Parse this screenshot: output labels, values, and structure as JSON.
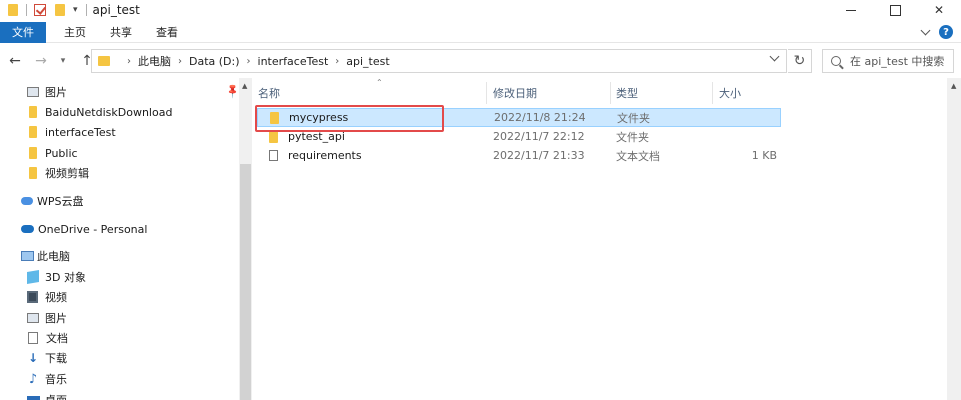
{
  "window": {
    "title": "api_test"
  },
  "ribbon": {
    "tabs": [
      "文件",
      "主页",
      "共享",
      "查看"
    ]
  },
  "address": {
    "crumbs": [
      "此电脑",
      "Data (D:)",
      "interfaceTest",
      "api_test"
    ]
  },
  "search": {
    "placeholder": "在 api_test 中搜索"
  },
  "sidebar": {
    "items": [
      {
        "label": "图片",
        "icon": "pictures-icon"
      },
      {
        "label": "BaiduNetdiskDownload",
        "icon": "folder-icon"
      },
      {
        "label": "interfaceTest",
        "icon": "folder-icon"
      },
      {
        "label": "Public",
        "icon": "folder-icon"
      },
      {
        "label": "视频剪辑",
        "icon": "folder-icon"
      },
      {
        "label": "WPS云盘",
        "icon": "cloud-icon"
      },
      {
        "label": "OneDrive - Personal",
        "icon": "onedrive-icon"
      },
      {
        "label": "此电脑",
        "icon": "this-pc-icon"
      },
      {
        "label": "3D 对象",
        "icon": "3d-objects-icon"
      },
      {
        "label": "视频",
        "icon": "videos-icon"
      },
      {
        "label": "图片",
        "icon": "pictures-icon"
      },
      {
        "label": "文档",
        "icon": "documents-icon"
      },
      {
        "label": "下载",
        "icon": "downloads-icon"
      },
      {
        "label": "音乐",
        "icon": "music-icon"
      },
      {
        "label": "桌面",
        "icon": "desktop-icon"
      }
    ]
  },
  "columns": {
    "name": "名称",
    "date": "修改日期",
    "type": "类型",
    "size": "大小"
  },
  "files": [
    {
      "name": "mycypress",
      "date": "2022/11/8 21:24",
      "type": "文件夹",
      "size": "",
      "icon": "folder-icon",
      "selected": true
    },
    {
      "name": "pytest_api",
      "date": "2022/11/7 22:12",
      "type": "文件夹",
      "size": "",
      "icon": "folder-icon",
      "selected": false
    },
    {
      "name": "requirements",
      "date": "2022/11/7 21:33",
      "type": "文本文档",
      "size": "1 KB",
      "icon": "text-file-icon",
      "selected": false
    }
  ],
  "colors": {
    "file_tab": "#1a6fbf",
    "selection_bg": "#cce8ff",
    "highlight_box": "#e34a4a",
    "folder": "#f5c542"
  }
}
